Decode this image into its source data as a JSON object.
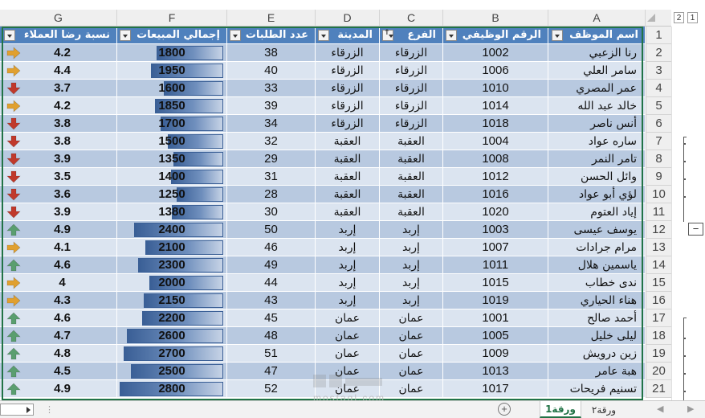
{
  "columns": [
    "G",
    "F",
    "E",
    "D",
    "C",
    "B",
    "A"
  ],
  "outline_levels": [
    "2",
    "1"
  ],
  "collapse_symbol": "−",
  "header": {
    "row_number": "1",
    "col_G": "نسبة رضا العملاء",
    "col_F": "إجمالي المبيعات",
    "col_E": "عدد الطلبات",
    "col_D": "المدينة",
    "col_C": "الفرع",
    "col_B": "الرقم الوظيفي",
    "col_A": "اسم الموظف"
  },
  "icon_colors": {
    "up": "#5a9e6f",
    "side": "#e0a030",
    "down": "#c0392b"
  },
  "bar_max": 2800,
  "rows": [
    {
      "n": "2",
      "name": "رنا الزعبي",
      "id": "1002",
      "branch": "الزرقاء",
      "city": "الزرقاء",
      "orders": "38",
      "sales": 1800,
      "sat": "4.2",
      "icon": "side"
    },
    {
      "n": "3",
      "name": "سامر العلي",
      "id": "1006",
      "branch": "الزرقاء",
      "city": "الزرقاء",
      "orders": "40",
      "sales": 1950,
      "sat": "4.4",
      "icon": "side"
    },
    {
      "n": "4",
      "name": "عمر المصري",
      "id": "1010",
      "branch": "الزرقاء",
      "city": "الزرقاء",
      "orders": "33",
      "sales": 1600,
      "sat": "3.7",
      "icon": "down"
    },
    {
      "n": "5",
      "name": "خالد عبد الله",
      "id": "1014",
      "branch": "الزرقاء",
      "city": "الزرقاء",
      "orders": "39",
      "sales": 1850,
      "sat": "4.2",
      "icon": "side"
    },
    {
      "n": "6",
      "name": "أنس ناصر",
      "id": "1018",
      "branch": "الزرقاء",
      "city": "الزرقاء",
      "orders": "34",
      "sales": 1700,
      "sat": "3.8",
      "icon": "down"
    },
    {
      "n": "7",
      "name": "ساره عواد",
      "id": "1004",
      "branch": "العقبة",
      "city": "العقبة",
      "orders": "32",
      "sales": 1500,
      "sat": "3.8",
      "icon": "down"
    },
    {
      "n": "8",
      "name": "تامر النمر",
      "id": "1008",
      "branch": "العقبة",
      "city": "العقبة",
      "orders": "29",
      "sales": 1350,
      "sat": "3.9",
      "icon": "down"
    },
    {
      "n": "9",
      "name": "وائل الحسن",
      "id": "1012",
      "branch": "العقبة",
      "city": "العقبة",
      "orders": "31",
      "sales": 1400,
      "sat": "3.5",
      "icon": "down"
    },
    {
      "n": "10",
      "name": "لؤي أبو عواد",
      "id": "1016",
      "branch": "العقبة",
      "city": "العقبة",
      "orders": "28",
      "sales": 1250,
      "sat": "3.6",
      "icon": "down"
    },
    {
      "n": "11",
      "name": "إياد العتوم",
      "id": "1020",
      "branch": "العقبة",
      "city": "العقبة",
      "orders": "30",
      "sales": 1380,
      "sat": "3.9",
      "icon": "down"
    },
    {
      "n": "12",
      "name": "يوسف عيسى",
      "id": "1003",
      "branch": "إربد",
      "city": "إربد",
      "orders": "50",
      "sales": 2400,
      "sat": "4.9",
      "icon": "up"
    },
    {
      "n": "13",
      "name": "مرام جرادات",
      "id": "1007",
      "branch": "إربد",
      "city": "إربد",
      "orders": "46",
      "sales": 2100,
      "sat": "4.1",
      "icon": "side"
    },
    {
      "n": "14",
      "name": "ياسمين هلال",
      "id": "1011",
      "branch": "إربد",
      "city": "إربد",
      "orders": "49",
      "sales": 2300,
      "sat": "4.6",
      "icon": "up"
    },
    {
      "n": "15",
      "name": "ندى خطاب",
      "id": "1015",
      "branch": "إربد",
      "city": "إربد",
      "orders": "44",
      "sales": 2000,
      "sat": "4",
      "icon": "side"
    },
    {
      "n": "16",
      "name": "هناء الحياري",
      "id": "1019",
      "branch": "إربد",
      "city": "إربد",
      "orders": "43",
      "sales": 2150,
      "sat": "4.3",
      "icon": "side"
    },
    {
      "n": "17",
      "name": "أحمد صالح",
      "id": "1001",
      "branch": "عمان",
      "city": "عمان",
      "orders": "45",
      "sales": 2200,
      "sat": "4.6",
      "icon": "up"
    },
    {
      "n": "18",
      "name": "ليلى خليل",
      "id": "1005",
      "branch": "عمان",
      "city": "عمان",
      "orders": "48",
      "sales": 2600,
      "sat": "4.7",
      "icon": "up"
    },
    {
      "n": "19",
      "name": "زين درويش",
      "id": "1009",
      "branch": "عمان",
      "city": "عمان",
      "orders": "51",
      "sales": 2700,
      "sat": "4.8",
      "icon": "up"
    },
    {
      "n": "20",
      "name": "هبة عامر",
      "id": "1013",
      "branch": "عمان",
      "city": "عمان",
      "orders": "47",
      "sales": 2500,
      "sat": "4.5",
      "icon": "up"
    },
    {
      "n": "21",
      "name": "تسنيم فريحات",
      "id": "1017",
      "branch": "عمان",
      "city": "عمان",
      "orders": "52",
      "sales": 2800,
      "sat": "4.9",
      "icon": "up"
    }
  ],
  "sheet_tabs": {
    "active": "ورقة1",
    "other": "ورقة٢",
    "add_symbol": "+"
  },
  "watermark": "mostaql.com"
}
